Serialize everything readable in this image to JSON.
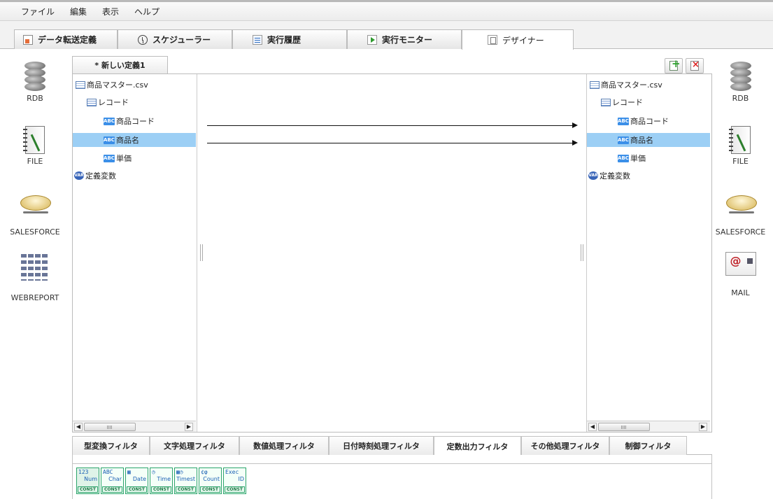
{
  "menu": {
    "file": "ファイル",
    "edit": "編集",
    "view": "表示",
    "help": "ヘルプ"
  },
  "tabs": [
    {
      "label": "データ転送定義",
      "icon": "document-icon"
    },
    {
      "label": "スケジューラー",
      "icon": "clock-icon"
    },
    {
      "label": "実行履歴",
      "icon": "history-icon"
    },
    {
      "label": "実行モニター",
      "icon": "play-icon"
    },
    {
      "label": "デザイナー",
      "icon": "designer-icon",
      "active": true
    }
  ],
  "left_palette": [
    {
      "label": "RDB",
      "icon": "database-icon"
    },
    {
      "label": "FILE",
      "icon": "file-notebook-icon"
    },
    {
      "label": "SALESFORCE",
      "icon": "cloud-icon"
    },
    {
      "label": "WEBREPORT",
      "icon": "webreport-icon"
    }
  ],
  "right_palette": [
    {
      "label": "RDB",
      "icon": "database-icon"
    },
    {
      "label": "FILE",
      "icon": "file-notebook-icon"
    },
    {
      "label": "SALESFORCE",
      "icon": "cloud-icon"
    },
    {
      "label": "MAIL",
      "icon": "mail-icon"
    }
  ],
  "designer": {
    "definition_tab": "* 新しい定義1",
    "source_tree": [
      {
        "label": "商品マスター.csv",
        "icon": "table-icon",
        "level": 0
      },
      {
        "label": "レコード",
        "icon": "record-icon",
        "level": 1
      },
      {
        "label": "商品コード",
        "icon": "abc-field-icon",
        "level": 2
      },
      {
        "label": "商品名",
        "icon": "abc-field-icon",
        "level": 2,
        "selected": true
      },
      {
        "label": "単価",
        "icon": "abc-field-icon",
        "level": 2
      },
      {
        "label": "定義変数",
        "icon": "var-icon",
        "level": 0
      }
    ],
    "target_tree": [
      {
        "label": "商品マスター.csv",
        "icon": "table-icon",
        "level": 0
      },
      {
        "label": "レコード",
        "icon": "record-icon",
        "level": 1
      },
      {
        "label": "商品コード",
        "icon": "abc-field-icon",
        "level": 2
      },
      {
        "label": "商品名",
        "icon": "abc-field-icon",
        "level": 2,
        "selected": true
      },
      {
        "label": "単価",
        "icon": "abc-field-icon",
        "level": 2
      },
      {
        "label": "定義変数",
        "icon": "var-icon",
        "level": 0
      }
    ],
    "mappings": [
      {
        "from": "商品コード",
        "to": "商品コード"
      },
      {
        "from": "商品名",
        "to": "商品名"
      }
    ]
  },
  "filter_tabs": [
    {
      "label": "型変換フィルタ"
    },
    {
      "label": "文字処理フィルタ"
    },
    {
      "label": "数値処理フィルタ"
    },
    {
      "label": "日付時刻処理フィルタ"
    },
    {
      "label": "定数出力フィルタ",
      "active": true
    },
    {
      "label": "その他処理フィルタ"
    },
    {
      "label": "制御フィルタ"
    }
  ],
  "const_filters": [
    {
      "top": "123",
      "sub": "Num",
      "badge": "CONST"
    },
    {
      "top": "ABC",
      "sub": "Char",
      "badge": "CONST"
    },
    {
      "top": "▦",
      "sub": "Date",
      "badge": "CONST"
    },
    {
      "top": "◷",
      "sub": "Time",
      "badge": "CONST"
    },
    {
      "top": "▦◷",
      "sub": "Timest",
      "badge": "CONST"
    },
    {
      "top": "¢φ",
      "sub": "Count",
      "badge": "CONST"
    },
    {
      "top": "Exec",
      "sub": "ID",
      "badge": "CONST"
    }
  ],
  "colors": {
    "selected_row": "#9ccff5",
    "abc_icon": "#3b8fe8",
    "const_border": "#2aa46a"
  }
}
